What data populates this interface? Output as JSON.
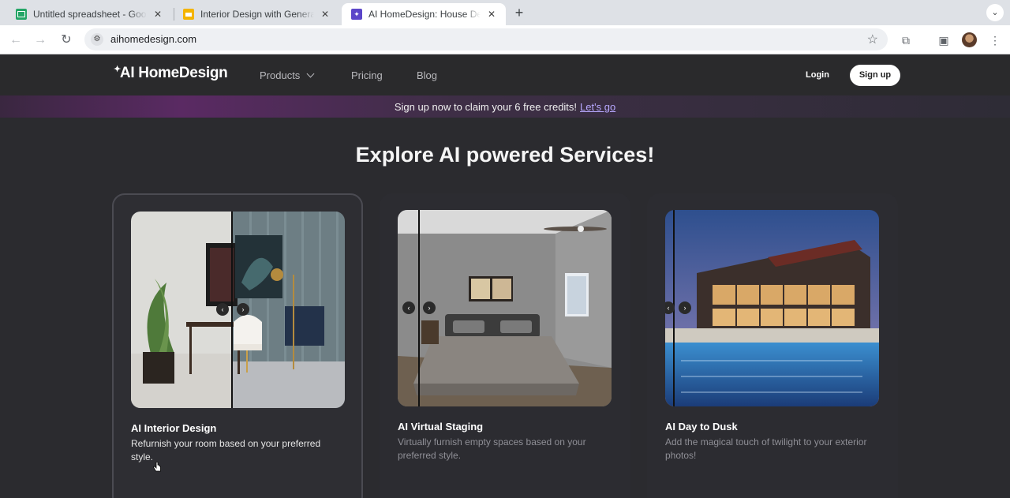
{
  "browser": {
    "tabs": [
      {
        "title": "Untitled spreadsheet - Google Sheets",
        "icon": "sheets-icon"
      },
      {
        "title": "Interior Design with Generative AI",
        "icon": "slides-icon"
      },
      {
        "title": "AI HomeDesign: House Design",
        "icon": "ai-homedesign-icon"
      }
    ],
    "close_glyph": "✕",
    "new_tab_glyph": "+",
    "tab_search_glyph": "⌄",
    "url": "aihomedesign.com"
  },
  "site": {
    "logo_spark": "✦",
    "logo_text": "AI HomeDesign",
    "nav": {
      "products": "Products",
      "pricing": "Pricing",
      "blog": "Blog"
    },
    "login": "Login",
    "signup": "Sign up"
  },
  "banner": {
    "text": "Sign up now to claim your 6 free credits!",
    "link": "Let's go"
  },
  "hero": {
    "title": "Explore AI powered Services!"
  },
  "cards": [
    {
      "title": "AI Interior Design",
      "description": "Refurnish your room based on your preferred style."
    },
    {
      "title": "AI Virtual Staging",
      "description": "Virtually furnish empty spaces based on your preferred style."
    },
    {
      "title": "AI Day to Dusk",
      "description": "Add the magical touch of twilight to your exterior photos!"
    }
  ],
  "slider_prev": "‹",
  "slider_next": "›"
}
